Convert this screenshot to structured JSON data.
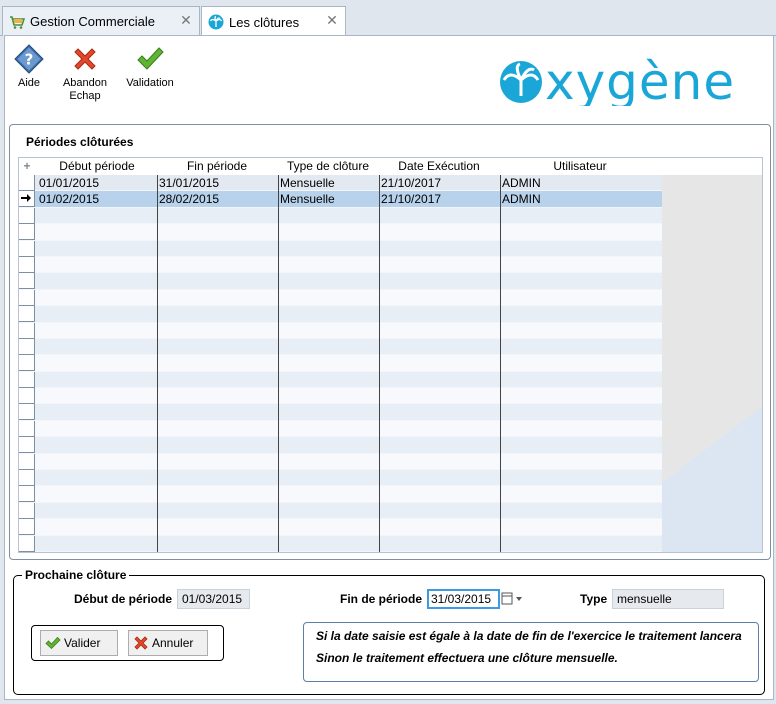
{
  "tabs": [
    {
      "label": "Gestion Commerciale",
      "icon": "cart-icon",
      "active": false
    },
    {
      "label": "Les clôtures",
      "icon": "palm-icon",
      "active": true
    }
  ],
  "toolbar": {
    "help_label": "Aide",
    "cancel_label_1": "Abandon",
    "cancel_label_2": "Echap",
    "validate_label": "Validation"
  },
  "logo_text": "oxygène",
  "periods": {
    "title": "Périodes clôturées",
    "columns": [
      "Début période",
      "Fin période",
      "Type de clôture",
      "Date Exécution",
      "Utilisateur"
    ],
    "rows": [
      {
        "debut": "01/01/2015",
        "fin": "31/01/2015",
        "type": "Mensuelle",
        "date_exec": "21/10/2017",
        "user": "ADMIN",
        "selected": false
      },
      {
        "debut": "01/02/2015",
        "fin": "28/02/2015",
        "type": "Mensuelle",
        "date_exec": "21/10/2017",
        "user": "ADMIN",
        "selected": true
      }
    ]
  },
  "next": {
    "title": "Prochaine clôture",
    "debut_label": "Début de période",
    "debut_value": "01/03/2015",
    "fin_label": "Fin de période",
    "fin_value": "31/03/2015",
    "type_label": "Type",
    "type_value": "mensuelle",
    "valider_label": "Valider",
    "annuler_label": "Annuler",
    "info_line1": "Si la date saisie est égale à la date de fin de l'exercice le traitement lancera",
    "info_line2": "Sinon le traitement effectuera une clôture mensuelle."
  },
  "colors": {
    "accent": "#3d9be0",
    "logo": "#1aa6d6",
    "selected_row": "#b8d2ec"
  }
}
